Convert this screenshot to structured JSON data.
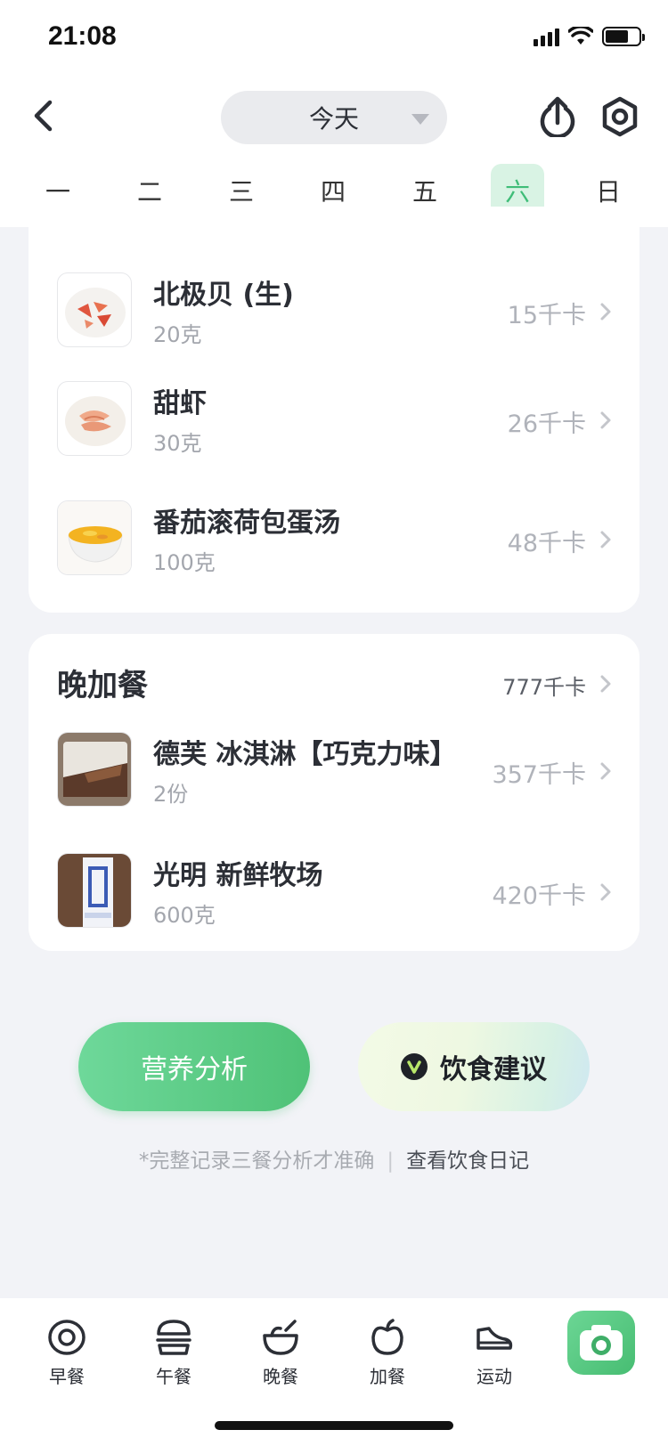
{
  "status_bar": {
    "time": "21:08"
  },
  "header": {
    "date_label": "今天",
    "weekdays": [
      "一",
      "二",
      "三",
      "四",
      "五",
      "六",
      "日"
    ],
    "active_weekday": "六"
  },
  "meal_items": [
    {
      "name": "北极贝 (生)",
      "quantity": "20克",
      "kcal": "15千卡"
    },
    {
      "name": "甜虾",
      "quantity": "30克",
      "kcal": "26千卡"
    },
    {
      "name": "番茄滚荷包蛋汤",
      "quantity": "100克",
      "kcal": "48千卡"
    }
  ],
  "snack": {
    "title": "晚加餐",
    "total": "777千卡",
    "items": [
      {
        "name": "德芙 冰淇淋【巧克力味】",
        "quantity": "2份",
        "kcal": "357千卡"
      },
      {
        "name": "光明 新鲜牧场",
        "quantity": "600克",
        "kcal": "420千卡"
      }
    ]
  },
  "actions": {
    "analysis": "营养分析",
    "advice": "饮食建议",
    "hint": "*完整记录三餐分析才准确",
    "diary_link": "查看饮食日记"
  },
  "tabs": [
    {
      "label": "早餐",
      "icon": "egg-icon"
    },
    {
      "label": "午餐",
      "icon": "burger-icon"
    },
    {
      "label": "晚餐",
      "icon": "bowl-icon"
    },
    {
      "label": "加餐",
      "icon": "apple-icon"
    },
    {
      "label": "运动",
      "icon": "shoe-icon"
    }
  ],
  "colors": {
    "accent": "#4fc277",
    "active_day_bg": "#d9f3e4"
  }
}
